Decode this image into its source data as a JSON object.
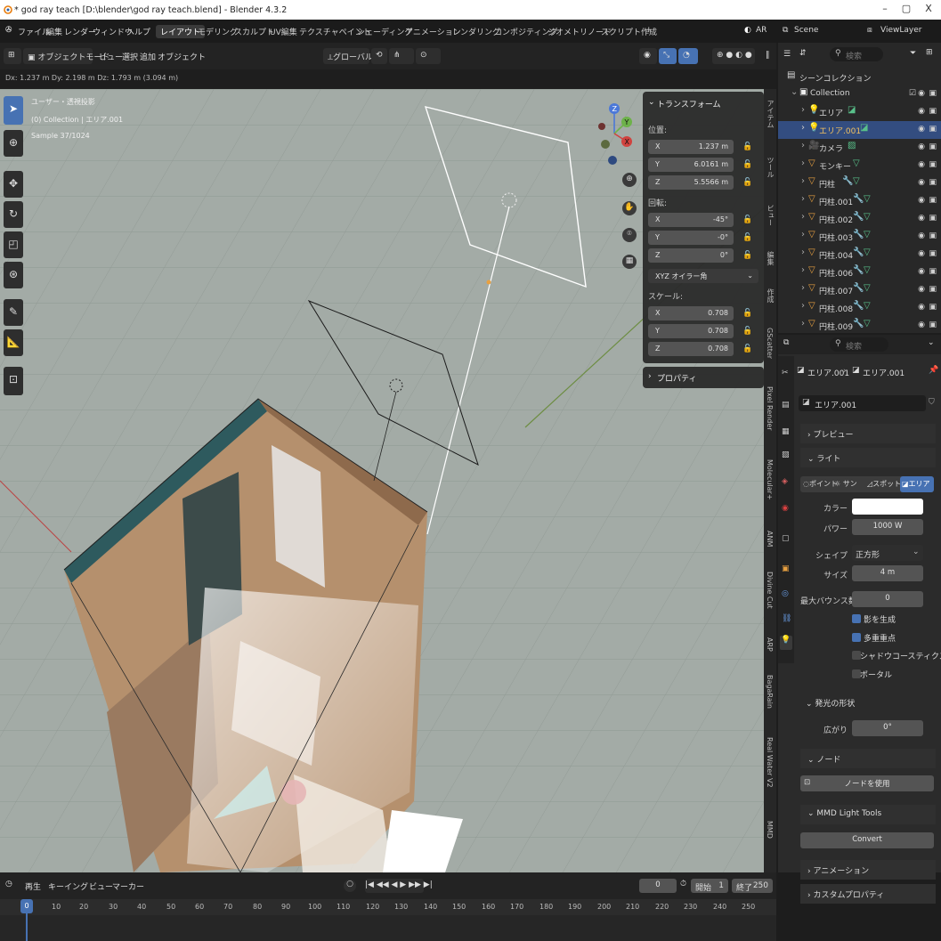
{
  "window": {
    "title": "* god ray teach [D:\\blender\\god ray teach.blend] - Blender 4.3.2",
    "minimize": "–",
    "maximize": "▢",
    "close": "X"
  },
  "menu": {
    "items": [
      "ファイル",
      "編集",
      "レンダー",
      "ウィンドウ",
      "ヘルプ"
    ],
    "workspaces": [
      "レイアウト",
      "モデリング",
      "スカルプト",
      "UV編集",
      "テクスチャペイント",
      "シェーディング",
      "アニメーション",
      "レンダリング",
      "コンポジティング",
      "ジオメトリノード",
      "スクリプト作成"
    ],
    "add_tab": "+",
    "ar": "AR",
    "scene": "Scene",
    "viewlayer": "ViewLayer"
  },
  "vp_header": {
    "mode": "オブジェクトモード",
    "menus": [
      "ビュー",
      "選択",
      "追加",
      "オブジェクト"
    ],
    "orientation": "グローバル"
  },
  "vp_info": {
    "delta": "Dx: 1.237 m  Dy: 2.198 m  Dz: 1.793 m (3.094 m)"
  },
  "overlay": {
    "view": "ユーザー・透視投影",
    "collection": "(0) Collection | エリア.001",
    "sample": "Sample 37/1024"
  },
  "npanel": {
    "title": "トランスフォーム",
    "location_label": "位置:",
    "location": [
      {
        "axis": "X",
        "value": "1.237 m"
      },
      {
        "axis": "Y",
        "value": "6.0161 m"
      },
      {
        "axis": "Z",
        "value": "5.5566 m"
      }
    ],
    "rotation_label": "回転:",
    "rotation": [
      {
        "axis": "X",
        "value": "-45°"
      },
      {
        "axis": "Y",
        "value": "-0°"
      },
      {
        "axis": "Z",
        "value": "0°"
      }
    ],
    "rotation_mode": "XYZ オイラー角",
    "scale_label": "スケール:",
    "scale": [
      {
        "axis": "X",
        "value": "0.708"
      },
      {
        "axis": "Y",
        "value": "0.708"
      },
      {
        "axis": "Z",
        "value": "0.708"
      }
    ],
    "properties": "プロパティ"
  },
  "side_tabs": [
    "アイテム",
    "ツール",
    "ビュー",
    "編集",
    "作成",
    "GScatter",
    "Pixel Render",
    "Molecular+",
    "ANM",
    "Divine Cut",
    "ARP",
    "BagaRain",
    "Real Water V2",
    "MMD"
  ],
  "outliner": {
    "search_placeholder": "検索",
    "scene_collection": "シーンコレクション",
    "collection": "Collection",
    "rows": [
      "エリア",
      "エリア.001",
      "カメラ",
      "モンキー",
      "円柱",
      "円柱.001",
      "円柱.002",
      "円柱.003",
      "円柱.004",
      "円柱.006",
      "円柱.007",
      "円柱.008",
      "円柱.009"
    ]
  },
  "props": {
    "search_placeholder": "検索",
    "breadcrumb_obj": "エリア.001",
    "breadcrumb_data": "エリア.001",
    "datablock": "エリア.001",
    "preview": "プレビュー",
    "light": "ライト",
    "light_types": [
      "ポイント",
      "サン",
      "スポット",
      "エリア"
    ],
    "color_label": "カラー",
    "power_label": "パワー",
    "power": "1000 W",
    "shape_label": "シェイプ",
    "shape": "正方形",
    "size_label": "サイズ",
    "size": "4 m",
    "bounces_label": "最大バウンス数",
    "bounces": "0",
    "cast_shadow": "影を生成",
    "mis": "多重重点",
    "caustics": "シャドウコースティクス",
    "portal": "ポータル",
    "beam_shape": "発光の形状",
    "spread_label": "広がり",
    "spread": "0°",
    "nodes": "ノード",
    "use_nodes": "ノードを使用",
    "mmd": "MMD Light Tools",
    "convert": "Convert",
    "animation": "アニメーション",
    "custom_props": "カスタムプロパティ"
  },
  "timeline": {
    "menus": [
      "再生",
      "キーイング",
      "ビュー",
      "マーカー"
    ],
    "current": "0",
    "start_label": "開始",
    "start": "1",
    "end_label": "終了",
    "end": "250",
    "ticks": [
      "0",
      "10",
      "20",
      "30",
      "40",
      "50",
      "60",
      "70",
      "80",
      "90",
      "100",
      "110",
      "120",
      "130",
      "140",
      "150",
      "160",
      "170",
      "180",
      "190",
      "200",
      "210",
      "220",
      "230",
      "240",
      "250"
    ]
  },
  "colors": {
    "accent": "#4772b3",
    "selected": "#334d80",
    "bg": "#1d1d1d",
    "viewport": "#9ea7a1"
  }
}
